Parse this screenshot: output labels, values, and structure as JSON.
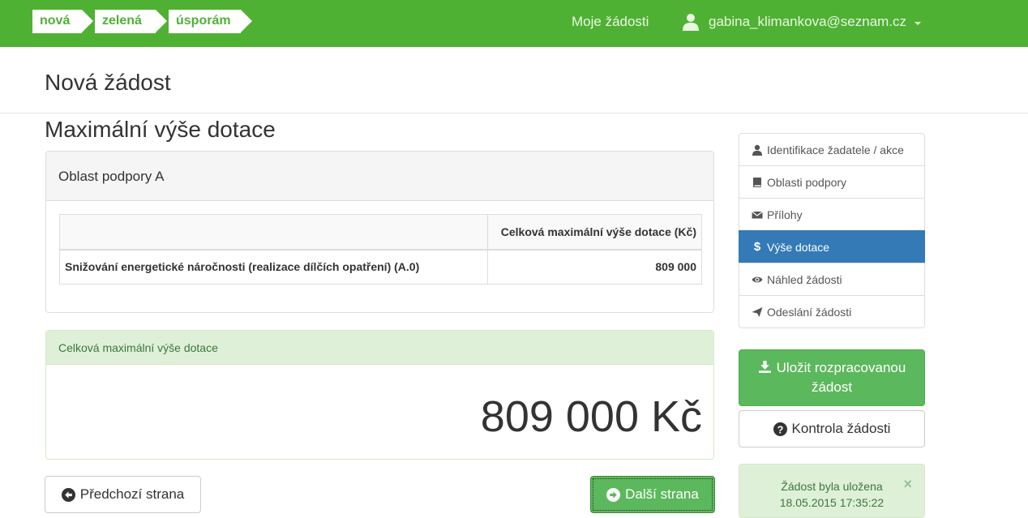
{
  "logo": {
    "seg1": "nová",
    "seg2": "zelená",
    "seg3": "úsporám"
  },
  "navbar": {
    "my_requests": "Moje žádosti",
    "user_email": "gabina_klimankova@seznam.cz"
  },
  "page": {
    "title": "Nová žádost",
    "section_title": "Maximální výše dotace"
  },
  "panel_a": {
    "heading": "Oblast podpory A",
    "table": {
      "headers": [
        "",
        "Celková maximální výše dotace (Kč)"
      ],
      "rows": [
        [
          "Snižování energetické náročnosti (realizace dílčích opatření) (A.0)",
          "809 000"
        ]
      ]
    }
  },
  "total_panel": {
    "heading": "Celková maximální výše dotace",
    "amount": "809 000 Kč"
  },
  "buttons": {
    "prev": "Předchozí strana",
    "next": "Další strana",
    "save": "Uložit rozpracovanou žádost",
    "check": "Kontrola žádosti"
  },
  "sidebar": {
    "items": [
      {
        "label": "Identifikace žadatele / akce",
        "icon": "user-icon"
      },
      {
        "label": "Oblasti podpory",
        "icon": "book-icon"
      },
      {
        "label": "Přílohy",
        "icon": "envelope-icon"
      },
      {
        "label": "Výše dotace",
        "icon": "dollar-icon",
        "active": true
      },
      {
        "label": "Náhled žádosti",
        "icon": "eye-icon"
      },
      {
        "label": "Odeslání žádosti",
        "icon": "send-icon"
      }
    ]
  },
  "alert": {
    "line1": "Žádost byla uložena",
    "line2": "18.05.2015 17:35:22",
    "close": "×"
  },
  "colors": {
    "brand_green": "#4fb133",
    "success": "#5cb85c",
    "active_blue": "#337ab7",
    "alert_bg": "#dff0d8"
  }
}
